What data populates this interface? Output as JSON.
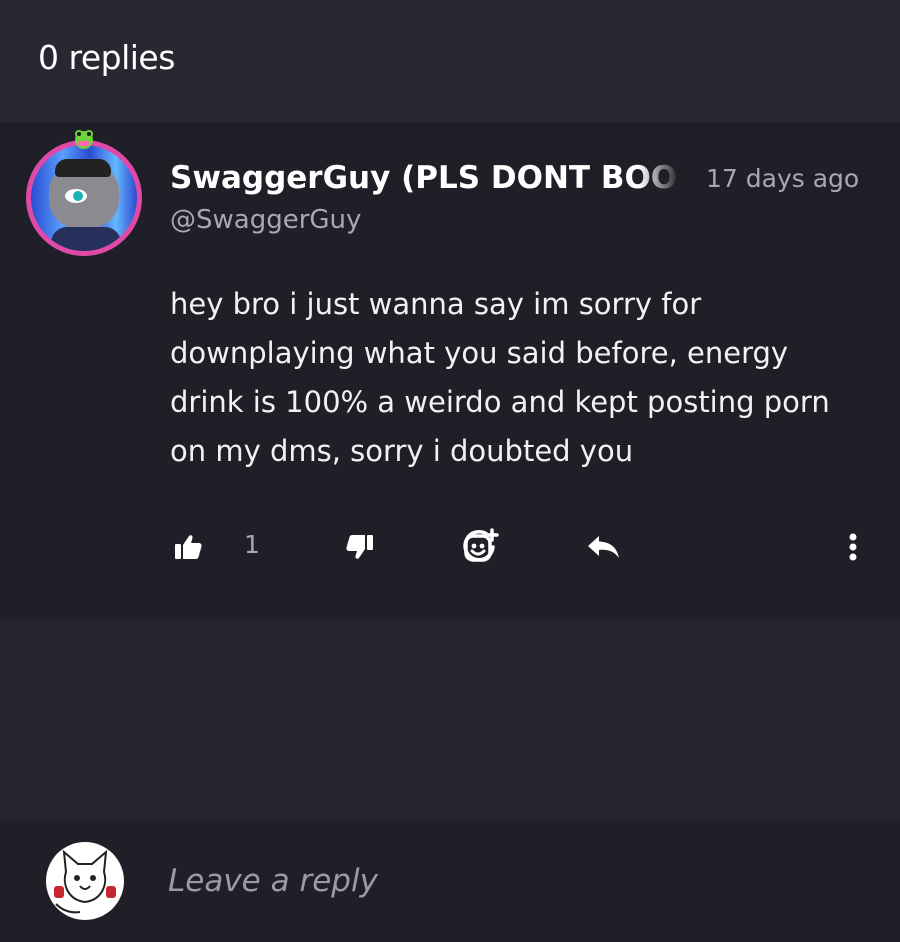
{
  "header": {
    "title": "0 replies"
  },
  "comment": {
    "username": "SwaggerGuy (PLS DONT BOO",
    "handle": "@SwaggerGuy",
    "timestamp": "17 days ago",
    "body": "hey bro i just wanna say im sorry for downplaying what you said before, energy drink is 100% a weirdo and kept posting porn on my dms, sorry i doubted you",
    "like_count": "1",
    "actions": {
      "like_icon": "thumbs-up-icon",
      "dislike_icon": "thumbs-down-icon",
      "react_icon": "add-reaction-icon",
      "reply_icon": "reply-arrow-icon",
      "more_icon": "more-vertical-icon"
    }
  },
  "reply_box": {
    "placeholder": "Leave a reply"
  },
  "colors": {
    "background": "#24252f",
    "panel": "#1f1f28",
    "header": "#272831",
    "muted_text": "#a7a8b2",
    "avatar_ring": "#e04aa6"
  }
}
